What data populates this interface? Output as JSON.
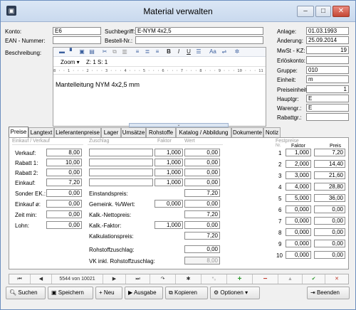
{
  "window": {
    "title": "Material verwalten",
    "minimize": "–",
    "maximize": "□",
    "close": "✕"
  },
  "header": {
    "konto_label": "Konto:",
    "konto_value": "E6",
    "ean_label": "EAN - Nummer:",
    "ean_value": "",
    "suchbegriff_label": "Suchbegriff:",
    "suchbegriff_value": "E-NYM 4x2,5",
    "bestellnr_label": "Bestell-Nr.:",
    "bestellnr_value": "",
    "beschreibung_label": "Beschreibung:",
    "zoom_label": "Zoom ▾",
    "zoom_pos": "Z:  1  S:  1",
    "ruler": "8 · · 1 · · · 2 · · · 3 · · · 4 · · · 5 · · · 6 · · · 7 · · · 8 · · · 9 · · · 10 · · · 11 · · · 1",
    "description_text": "Mantelleitung NYM 4x2,5 mm"
  },
  "right": {
    "anlage_label": "Anlage:",
    "anlage_value": "01.03.1993",
    "aenderung_label": "Änderung:",
    "aenderung_value": "25.09.2014",
    "mwst_label": "MwSt - KZ:",
    "mwst_value": "19",
    "erloes_label": "Erlöskonto:",
    "erloes_value": "",
    "gruppe_label": "Gruppe:",
    "gruppe_value": "010",
    "einheit_label": "Einheit:",
    "einheit_value": "m",
    "preiseinheit_label": "Preiseinheit:",
    "preiseinheit_value": "1",
    "hauptgr_label": "Hauptgr:",
    "hauptgr_value": "E",
    "warengr_label": "Warengr.:",
    "warengr_value": "E",
    "rabattgr_label": "Rabattgr.:",
    "rabattgr_value": ""
  },
  "tabs": [
    "Preise",
    "Langtext",
    "Lieferantenpreise",
    "Lager",
    "Umsätze",
    "Rohstoffe",
    "Katalog / Abbildung",
    "Dokumente",
    "Notiz"
  ],
  "preise": {
    "ek_vk_header": "Einkauf / Verkauf",
    "rows": [
      {
        "label": "Verkauf:",
        "value": "8,00"
      },
      {
        "label": "Rabatt 1:",
        "value": "10,00"
      },
      {
        "label": "Rabatt 2:",
        "value": "0,00"
      },
      {
        "label": "Einkauf:",
        "value": "7,20"
      },
      {
        "label": "Sonder EK.:",
        "value": "0,00"
      },
      {
        "label": "Einkauf ø:",
        "value": "0,00"
      },
      {
        "label": "Zeit min:",
        "value": "0,00"
      },
      {
        "label": "Lohn:",
        "value": "0,00"
      }
    ],
    "zuschlag_header": "Zuschlag",
    "faktor_header": "Faktor",
    "wert_header": "Wert",
    "zuschlag_rows": [
      {
        "name": "",
        "faktor": "1,000",
        "wert": "0,00"
      },
      {
        "name": "",
        "faktor": "1,000",
        "wert": "0,00"
      },
      {
        "name": "",
        "faktor": "1,000",
        "wert": "0,00"
      },
      {
        "name": "",
        "faktor": "1,000",
        "wert": "0,00"
      }
    ],
    "einstandspreis_label": "Einstandspreis:",
    "einstandspreis_value": "7,20",
    "gemeink_label": "Gemeink. %/Wert:",
    "gemeink_pct": "0,000",
    "gemeink_value": "0,00",
    "kalk_netto_label": "Kalk.-Nettopreis:",
    "kalk_netto_value": "7,20",
    "kalk_faktor_label": "Kalk.-Faktor:",
    "kalk_faktor_pct": "1,000",
    "kalk_faktor_value": "0,00",
    "kalkulationspreis_label": "Kalkulationspreis:",
    "kalkulationspreis_value": "7,20",
    "rohstoff_label": "Rohstoffzuschlag:",
    "rohstoff_value": "0,00",
    "vk_label": "VK inkl. Rohstoffzuschlag:",
    "vk_value": "8,00",
    "festpreise_header": "Festpreise",
    "fp_nr": "Nr.",
    "fp_faktor": "Faktor",
    "fp_preis": "Preis",
    "festpreise": [
      {
        "nr": "1",
        "faktor": "1,000",
        "preis": "7,20"
      },
      {
        "nr": "2",
        "faktor": "2,000",
        "preis": "14,40"
      },
      {
        "nr": "3",
        "faktor": "3,000",
        "preis": "21,60"
      },
      {
        "nr": "4",
        "faktor": "4,000",
        "preis": "28,80"
      },
      {
        "nr": "5",
        "faktor": "5,000",
        "preis": "36,00"
      },
      {
        "nr": "6",
        "faktor": "0,000",
        "preis": "0,00"
      },
      {
        "nr": "7",
        "faktor": "0,000",
        "preis": "0,00"
      },
      {
        "nr": "8",
        "faktor": "0,000",
        "preis": "0,00"
      },
      {
        "nr": "9",
        "faktor": "0,000",
        "preis": "0,00"
      },
      {
        "nr": "10",
        "faktor": "0,000",
        "preis": "0,00"
      }
    ]
  },
  "navigator": {
    "first": "⏮",
    "prev": "◀",
    "record": "5544 von 10021",
    "next": "▶",
    "last": "⏭",
    "refresh": "↷",
    "star": "✱",
    "asterisk": "*₀",
    "add": "+",
    "remove": "−",
    "up": "▲",
    "check": "✔",
    "cancel": "✕"
  },
  "buttons": {
    "suchen": "Suchen",
    "speichern": "Speichern",
    "neu": "Neu",
    "ausgabe": "Ausgabe",
    "kopieren": "Kopieren",
    "optionen": "Optionen ▾",
    "beenden": "Beenden"
  },
  "colors": {
    "accent": "#3a5f9e",
    "add": "#2e9a2e",
    "remove": "#c0392b"
  }
}
